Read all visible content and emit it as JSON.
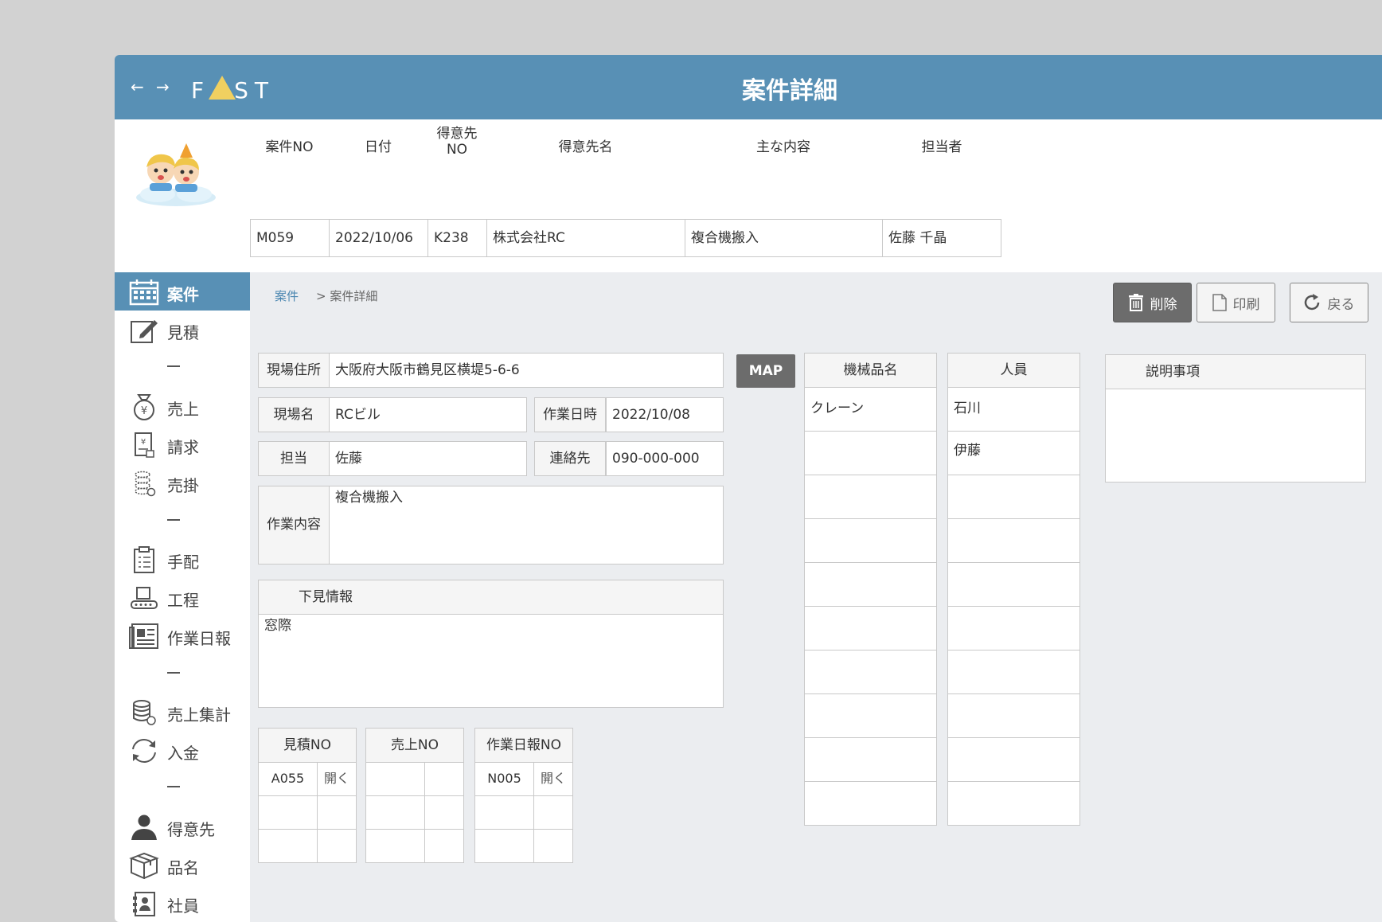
{
  "header": {
    "back_arrow": "←",
    "forward_arrow": "→",
    "logo_left": "F",
    "logo_right": "ST",
    "title": "案件詳細"
  },
  "summary": {
    "headers": [
      "案件NO",
      "日付",
      "得意先NO",
      "得意先名",
      "主な内容",
      "担当者"
    ],
    "header_line1_customer_no": "得意先",
    "header_line2_customer_no": "NO",
    "values": [
      "M059",
      "2022/10/06",
      "K238",
      "株式会社RC",
      "複合機搬入",
      "佐藤 千晶"
    ]
  },
  "sidebar": {
    "items": [
      {
        "label": "案件",
        "icon": "calendar-icon",
        "active": true
      },
      {
        "label": "見積",
        "icon": "edit-icon"
      },
      {
        "label": "売上",
        "icon": "money-bag-icon"
      },
      {
        "label": "請求",
        "icon": "invoice-icon"
      },
      {
        "label": "売掛",
        "icon": "coins-icon"
      },
      {
        "label": "手配",
        "icon": "clipboard-icon"
      },
      {
        "label": "工程",
        "icon": "conveyor-icon"
      },
      {
        "label": "作業日報",
        "icon": "newspaper-icon"
      },
      {
        "label": "売上集計",
        "icon": "coin-stack-icon"
      },
      {
        "label": "入金",
        "icon": "refresh-icon"
      },
      {
        "label": "得意先",
        "icon": "person-icon"
      },
      {
        "label": "品名",
        "icon": "box-icon"
      },
      {
        "label": "社員",
        "icon": "employee-icon"
      }
    ],
    "separator": "－"
  },
  "breadcrumb": {
    "root": "案件",
    "current": "> 案件詳細"
  },
  "actions": {
    "delete": "削除",
    "print": "印刷",
    "back": "戻る"
  },
  "form": {
    "site_address_label": "現場住所",
    "site_address": "大阪府大阪市鶴見区横堤5-6-6",
    "site_name_label": "現場名",
    "site_name": "RCビル",
    "work_datetime_label": "作業日時",
    "work_datetime": "2022/10/08",
    "person_label": "担当",
    "person": "佐藤",
    "contact_label": "連絡先",
    "contact": "090-000-000",
    "work_content_label": "作業内容",
    "work_content": "複合機搬入",
    "survey_label": "下見情報",
    "survey": "窓際",
    "map_button": "MAP"
  },
  "machines": {
    "header": "機械品名",
    "rows": [
      "クレーン",
      "",
      "",
      "",
      "",
      "",
      "",
      "",
      "",
      ""
    ]
  },
  "staff": {
    "header": "人員",
    "rows": [
      "石川",
      "伊藤",
      "",
      "",
      "",
      "",
      "",
      "",
      "",
      ""
    ]
  },
  "notes": {
    "header": "説明事項",
    "text": ""
  },
  "links": {
    "estimate": {
      "header": "見積NO",
      "rows": [
        {
          "no": "A055",
          "open": "開く"
        },
        {
          "no": "",
          "open": ""
        },
        {
          "no": "",
          "open": ""
        }
      ]
    },
    "sales": {
      "header": "売上NO",
      "rows": [
        {
          "no": "",
          "open": ""
        },
        {
          "no": "",
          "open": ""
        },
        {
          "no": "",
          "open": ""
        }
      ]
    },
    "daily_report": {
      "header": "作業日報NO",
      "rows": [
        {
          "no": "N005",
          "open": "開く"
        },
        {
          "no": "",
          "open": ""
        },
        {
          "no": "",
          "open": ""
        }
      ]
    }
  },
  "colors": {
    "header_bg": "#5890b5",
    "button_dark": "#6c6c6c",
    "panel_bg": "#ebedf0"
  }
}
